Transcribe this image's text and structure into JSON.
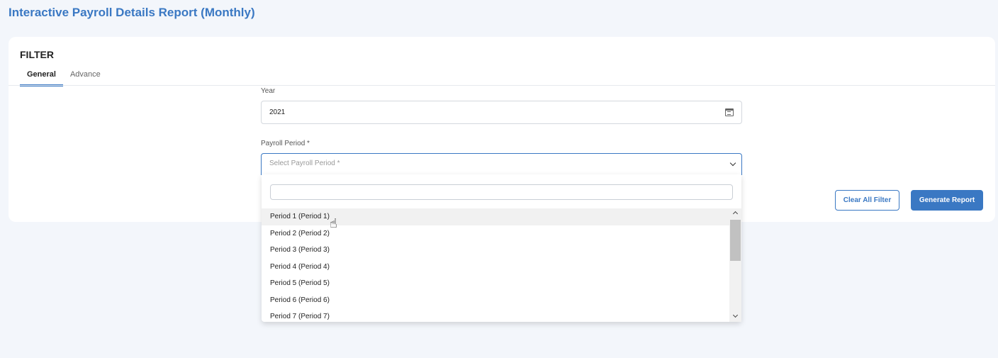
{
  "page": {
    "title": "Interactive Payroll Details Report (Monthly)"
  },
  "filter": {
    "heading": "FILTER",
    "tabs": [
      {
        "label": "General",
        "active": true
      },
      {
        "label": "Advance",
        "active": false
      }
    ],
    "year": {
      "label": "Year",
      "value": "2021",
      "icon": "calendar-icon"
    },
    "payroll_period": {
      "label": "Payroll Period *",
      "placeholder": "Select Payroll Period *",
      "search_value": "",
      "options": [
        "Period 1 (Period 1)",
        "Period 2 (Period 2)",
        "Period 3 (Period 3)",
        "Period 4 (Period 4)",
        "Period 5 (Period 5)",
        "Period 6 (Period 6)",
        "Period 7 (Period 7)"
      ],
      "hovered_index": 0
    },
    "buttons": {
      "clear": "Clear All Filter",
      "generate": "Generate Report"
    }
  },
  "colors": {
    "accent": "#3a78c3",
    "background": "#f3f6fb"
  }
}
